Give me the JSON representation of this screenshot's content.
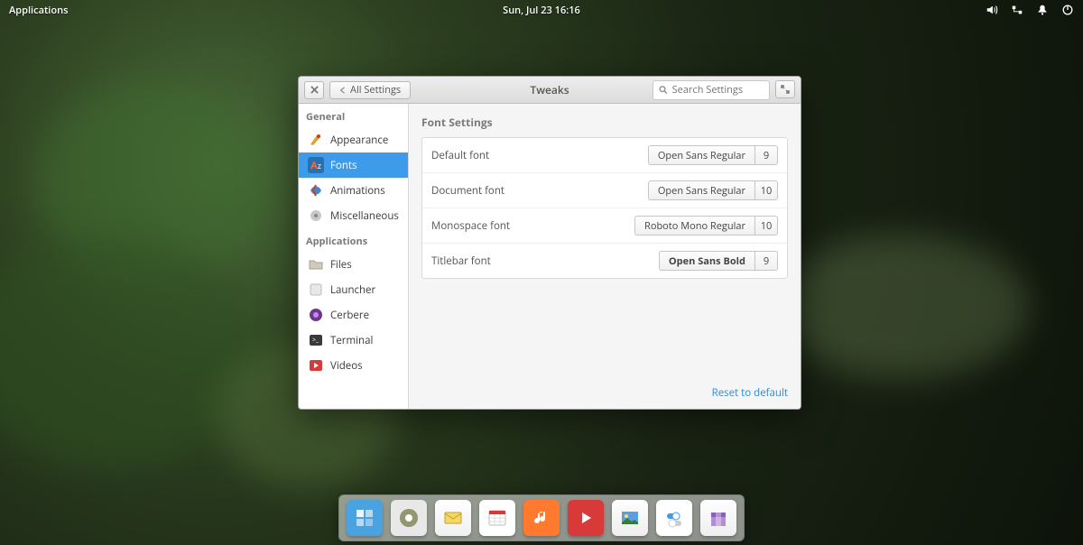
{
  "panel": {
    "applications_label": "Applications",
    "clock": "Sun, Jul 23   16:16"
  },
  "window": {
    "close_tooltip": "Close",
    "all_settings_label": "All Settings",
    "title": "Tweaks",
    "search_placeholder": "Search Settings",
    "maximize_tooltip": "Maximize"
  },
  "sidebar": {
    "general_header": "General",
    "general_items": [
      {
        "label": "Appearance",
        "icon": "appearance"
      },
      {
        "label": "Fonts",
        "icon": "fonts",
        "selected": true
      },
      {
        "label": "Animations",
        "icon": "animations"
      },
      {
        "label": "Miscellaneous",
        "icon": "misc"
      }
    ],
    "applications_header": "Applications",
    "app_items": [
      {
        "label": "Files",
        "icon": "files"
      },
      {
        "label": "Launcher",
        "icon": "launcher"
      },
      {
        "label": "Cerbere",
        "icon": "cerbere"
      },
      {
        "label": "Terminal",
        "icon": "terminal"
      },
      {
        "label": "Videos",
        "icon": "videos"
      }
    ]
  },
  "content": {
    "section_title": "Font Settings",
    "rows": [
      {
        "label": "Default font",
        "font": "Open Sans Regular",
        "size": "9",
        "bold": false
      },
      {
        "label": "Document font",
        "font": "Open Sans Regular",
        "size": "10",
        "bold": false
      },
      {
        "label": "Monospace font",
        "font": "Roboto Mono Regular",
        "size": "10",
        "bold": false
      },
      {
        "label": "Titlebar font",
        "font": "Open Sans Bold",
        "size": "9",
        "bold": true
      }
    ],
    "reset_label": "Reset to default"
  },
  "dock": {
    "items": [
      {
        "name": "multitasking",
        "bg": "#4aa3e0"
      },
      {
        "name": "web-browser",
        "bg": "#e8e8e8"
      },
      {
        "name": "mail",
        "bg": "#f4d860"
      },
      {
        "name": "calendar",
        "bg": "#ffffff"
      },
      {
        "name": "music",
        "bg": "#ff7a2f"
      },
      {
        "name": "videos",
        "bg": "#d83a3a"
      },
      {
        "name": "photos",
        "bg": "#5aa0e0"
      },
      {
        "name": "tweaks",
        "bg": "#ffffff"
      },
      {
        "name": "app-center",
        "bg": "#8a5fc0"
      }
    ]
  },
  "colors": {
    "accent": "#3d9be9",
    "link": "#2e8bd8"
  }
}
